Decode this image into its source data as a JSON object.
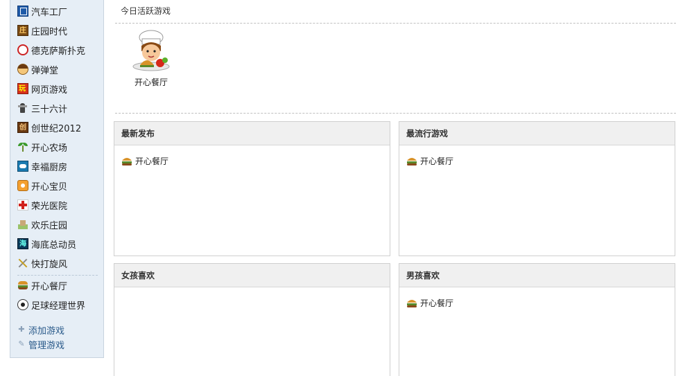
{
  "sidebar": {
    "items": [
      {
        "label": "汽车工厂",
        "icon": "car-factory-icon"
      },
      {
        "label": "庄园时代",
        "icon": "manor-icon"
      },
      {
        "label": "德克萨斯扑克",
        "icon": "poker-icon"
      },
      {
        "label": "弹弹堂",
        "icon": "ddt-icon"
      },
      {
        "label": "网页游戏",
        "icon": "webgame-icon"
      },
      {
        "label": "三十六计",
        "icon": "strategy-icon"
      },
      {
        "label": "创世纪2012",
        "icon": "genesis-icon"
      },
      {
        "label": "开心农场",
        "icon": "farm-icon"
      },
      {
        "label": "幸福厨房",
        "icon": "kitchen-icon"
      },
      {
        "label": "开心宝贝",
        "icon": "baby-icon"
      },
      {
        "label": "荣光医院",
        "icon": "hospital-icon"
      },
      {
        "label": "欢乐庄园",
        "icon": "garden-icon"
      },
      {
        "label": "海底总动员",
        "icon": "sea-icon"
      },
      {
        "label": "快打旋风",
        "icon": "fight-icon"
      }
    ],
    "my_games": [
      {
        "label": "开心餐厅",
        "icon": "burger-icon"
      },
      {
        "label": "足球经理世界",
        "icon": "soccer-icon"
      }
    ],
    "links": {
      "add": "添加游戏",
      "manage": "管理游戏"
    }
  },
  "main": {
    "today_title": "今日活跃游戏",
    "featured": {
      "label": "开心餐厅"
    },
    "panels": {
      "newest": {
        "title": "最新发布",
        "items": [
          "开心餐厅"
        ]
      },
      "popular": {
        "title": "最流行游戏",
        "items": [
          "开心餐厅"
        ]
      },
      "girls": {
        "title": "女孩喜欢",
        "items": []
      },
      "boys": {
        "title": "男孩喜欢",
        "items": [
          "开心餐厅"
        ]
      }
    }
  },
  "colors": {
    "sidebar_bg": "#e6eef6",
    "link": "#2a5a8a",
    "panel_head": "#f0f0f0"
  }
}
